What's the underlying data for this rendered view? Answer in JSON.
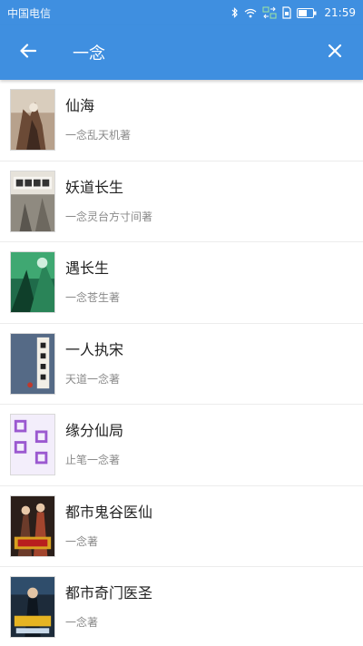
{
  "status_bar": {
    "carrier": "中国电信",
    "time": "21:59",
    "icons": [
      "bluetooth-icon",
      "wifi-icon",
      "data-transfer-icon",
      "sim-icon",
      "battery-icon"
    ]
  },
  "app_bar": {
    "back_icon": "arrow-left-icon",
    "query": "一念",
    "close_icon": "close-icon",
    "background_color": "#3f8fe0"
  },
  "results": [
    {
      "title": "仙海",
      "author": "一念乱天机著"
    },
    {
      "title": "妖道长生",
      "author": "一念灵台方寸间著"
    },
    {
      "title": "遇长生",
      "author": "一念苍生著"
    },
    {
      "title": "一人执宋",
      "author": "天道一念著"
    },
    {
      "title": "缘分仙局",
      "author": "止笔一念著"
    },
    {
      "title": "都市鬼谷医仙",
      "author": "一念著"
    },
    {
      "title": "都市奇门医圣",
      "author": "一念著"
    }
  ]
}
